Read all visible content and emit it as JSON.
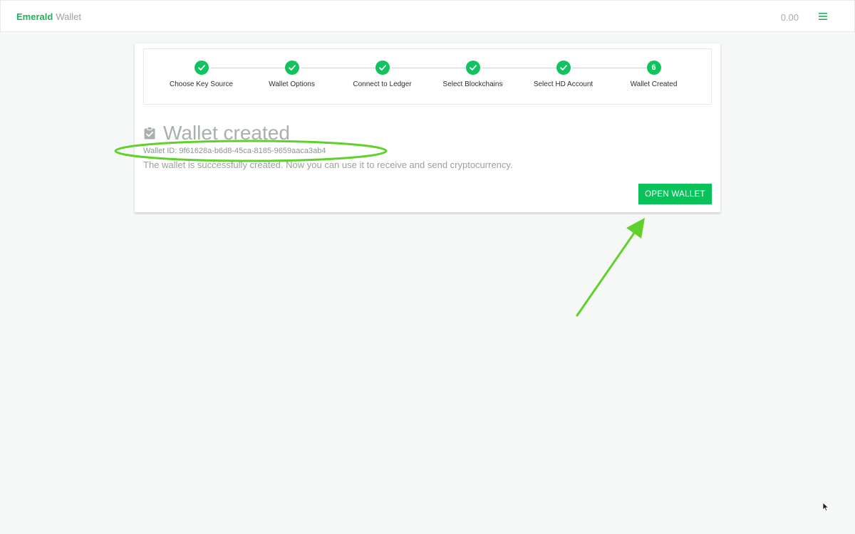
{
  "header": {
    "brand_primary": "Emerald",
    "brand_secondary": "Wallet",
    "balance": "0.00",
    "menu_icon": "hamburger-menu-icon"
  },
  "stepper": {
    "steps": [
      {
        "label": "Choose Key Source",
        "state": "done"
      },
      {
        "label": "Wallet Options",
        "state": "done"
      },
      {
        "label": "Connect to Ledger",
        "state": "done"
      },
      {
        "label": "Select Blockchains",
        "state": "done"
      },
      {
        "label": "Select HD Account",
        "state": "done"
      },
      {
        "label": "Wallet Created",
        "state": "active",
        "number": "6"
      }
    ]
  },
  "main": {
    "title": "Wallet created",
    "title_icon": "clipboard-check-icon",
    "wallet_id": "Wallet ID: 9f61628a-b6d8-45ca-8185-9659aaca3ab4",
    "description": "The wallet is successfully created. Now you can use it to receive and send cryptocurrency.",
    "open_button_label": "OPEN WALLET"
  },
  "colors": {
    "accent": "#0ac25a",
    "annotation": "#5fd12a"
  }
}
